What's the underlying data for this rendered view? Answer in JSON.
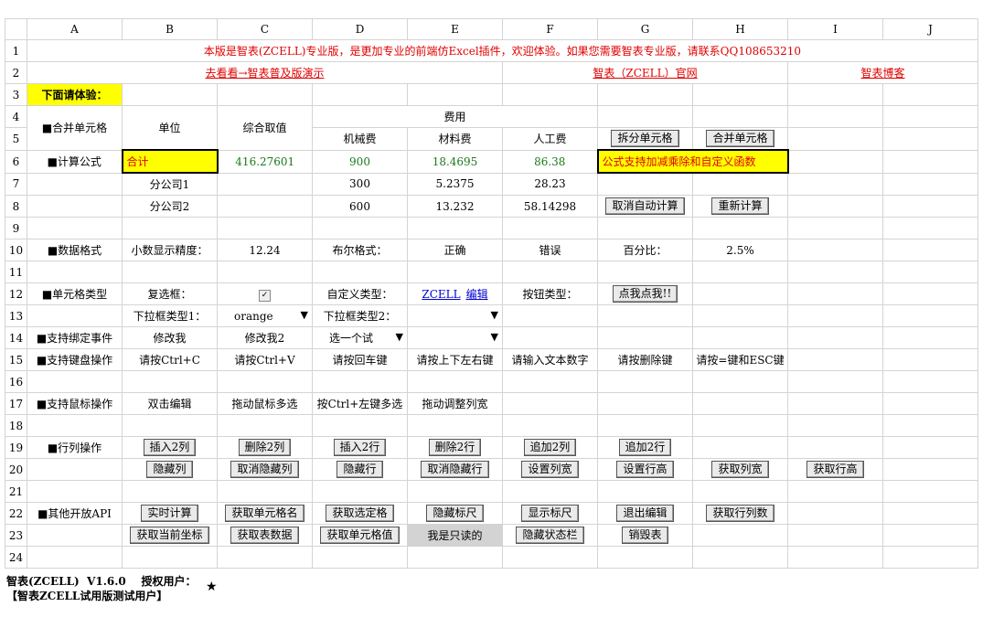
{
  "columns": [
    "A",
    "B",
    "C",
    "D",
    "E",
    "F",
    "G",
    "H",
    "I",
    "J"
  ],
  "rows": [
    "1",
    "2",
    "3",
    "4",
    "5",
    "6",
    "7",
    "8",
    "9",
    "10",
    "11",
    "12",
    "13",
    "14",
    "15",
    "16",
    "17",
    "18",
    "19",
    "20",
    "21",
    "22",
    "23",
    "24"
  ],
  "r1": {
    "notice": "本版是智表(ZCELL)专业版，是更加专业的前端仿Excel插件，欢迎体验。如果您需要智表专业版，请联系QQ108653210"
  },
  "r2": {
    "link1": "去看看→智表普及版演示",
    "link2": "智表（ZCELL）官网",
    "link3": "智表博客"
  },
  "r3": {
    "try": "下面请体验："
  },
  "r4": {
    "merge": "■合并单元格",
    "unit": "单位",
    "composite": "综合取值",
    "fee": "费用"
  },
  "r5": {
    "machine": "机械费",
    "material": "材料费",
    "labor": "人工费",
    "split_btn": "拆分单元格",
    "merge_btn": "合并单元格"
  },
  "r6": {
    "formula": "■计算公式",
    "total": "合计",
    "composite_val": "416.27601",
    "machine_val": "900",
    "material_val": "18.4695",
    "labor_val": "86.38",
    "note": "公式支持加减乘除和自定义函数"
  },
  "r7": {
    "unit": "分公司1",
    "machine_val": "300",
    "material_val": "5.2375",
    "labor_val": "28.23"
  },
  "r8": {
    "unit": "分公司2",
    "machine_val": "600",
    "material_val": "13.232",
    "labor_val": "58.14298",
    "cancel_btn": "取消自动计算",
    "recalc_btn": "重新计算"
  },
  "r10": {
    "label": "■数据格式",
    "precision_label": "小数显示精度：",
    "precision_val": "12.24",
    "bool_label": "布尔格式：",
    "true_val": "正确",
    "false_val": "错误",
    "pct_label": "百分比：",
    "pct_val": "2.5%"
  },
  "r12": {
    "label": "■单元格类型",
    "checkbox_label": "复选框：",
    "check_mark": "✓",
    "custom_label": "自定义类型：",
    "custom_link1": "ZCELL",
    "custom_link2": "编辑",
    "button_label": "按钮类型：",
    "click_btn": "点我点我!!"
  },
  "r13": {
    "dropdown1_label": "下拉框类型1：",
    "dropdown1_val": "orange",
    "dropdown2_label": "下拉框类型2：",
    "arrow": "▼"
  },
  "r14": {
    "label": "■支持绑定事件",
    "modify1": "修改我",
    "modify2": "修改我2",
    "select_try": "选一个试",
    "arrow": "▼"
  },
  "r15": {
    "label": "■支持键盘操作",
    "k1": "请按Ctrl+C",
    "k2": "请按Ctrl+V",
    "k3": "请按回车键",
    "k4": "请按上下左右键",
    "k5": "请输入文本数字",
    "k6": "请按删除键",
    "k7": "请按=键和ESC键"
  },
  "r17": {
    "label": "■支持鼠标操作",
    "m1": "双击编辑",
    "m2": "拖动鼠标多选",
    "m3": "按Ctrl+左键多选",
    "m4": "拖动调整列宽"
  },
  "r19": {
    "label": "■行列操作",
    "b1": "插入2列",
    "b2": "删除2列",
    "b3": "插入2行",
    "b4": "删除2行",
    "b5": "追加2列",
    "b6": "追加2行"
  },
  "r20": {
    "b1": "隐藏列",
    "b2": "取消隐藏列",
    "b3": "隐藏行",
    "b4": "取消隐藏行",
    "b5": "设置列宽",
    "b6": "设置行高",
    "b7": "获取列宽",
    "b8": "获取行高"
  },
  "r22": {
    "label": "■其他开放API",
    "b1": "实时计算",
    "b2": "获取单元格名",
    "b3": "获取选定格",
    "b4": "隐藏标尺",
    "b5": "显示标尺",
    "b6": "退出编辑",
    "b7": "获取行列数"
  },
  "r23": {
    "b1": "获取当前坐标",
    "b2": "获取表数据",
    "b3": "获取单元格值",
    "readonly": "我是只读的",
    "b5": "隐藏状态栏",
    "b6": "销毁表"
  },
  "footer": {
    "line1": "智表(ZCELL)  V1.6.0    授权用户：",
    "line2": "【智表ZCELL试用版测试用户】",
    "star": "★"
  },
  "colors": {
    "red": "#e00000",
    "green": "#1a7a1a",
    "yellow": "#ffff00",
    "link_blue": "#0000cc",
    "grid": "#d4d4d4"
  }
}
